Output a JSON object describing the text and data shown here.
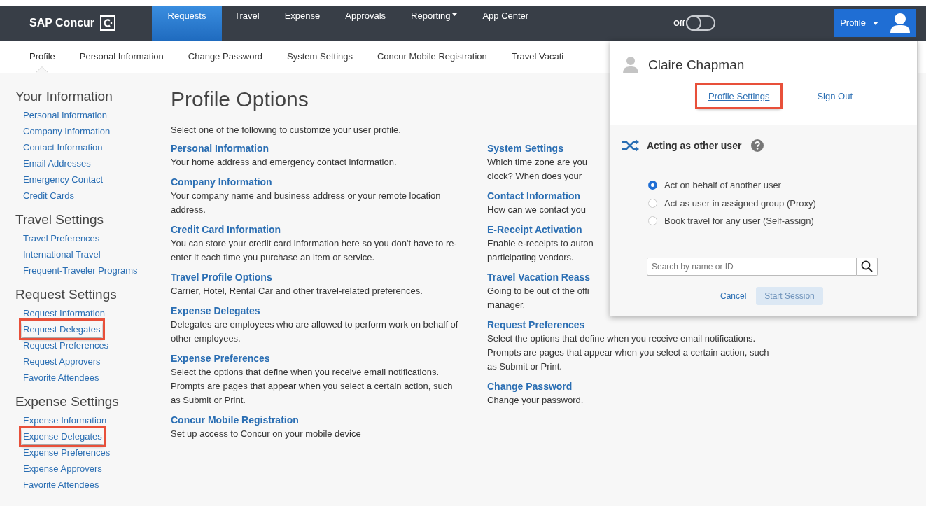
{
  "header": {
    "logo": "SAP Concur",
    "nav": [
      {
        "label": "Requests",
        "selected": true,
        "dropdown": false
      },
      {
        "label": "Travel",
        "selected": false,
        "dropdown": false
      },
      {
        "label": "Expense",
        "selected": false,
        "dropdown": false
      },
      {
        "label": "Approvals",
        "selected": false,
        "dropdown": false
      },
      {
        "label": "Reporting",
        "selected": false,
        "dropdown": true
      },
      {
        "label": "App Center",
        "selected": false,
        "dropdown": false
      }
    ],
    "toggle": {
      "label": "Off",
      "on": false
    },
    "profile_button": "Profile"
  },
  "subnav": [
    {
      "label": "Profile",
      "selected": true
    },
    {
      "label": "Personal Information",
      "selected": false
    },
    {
      "label": "Change Password",
      "selected": false
    },
    {
      "label": "System Settings",
      "selected": false
    },
    {
      "label": "Concur Mobile Registration",
      "selected": false
    },
    {
      "label": "Travel Vacati",
      "selected": false
    }
  ],
  "sidebar": [
    {
      "heading": "Your Information",
      "items": [
        {
          "label": "Personal Information",
          "highlighted": false
        },
        {
          "label": "Company Information",
          "highlighted": false
        },
        {
          "label": "Contact Information",
          "highlighted": false
        },
        {
          "label": "Email Addresses",
          "highlighted": false
        },
        {
          "label": "Emergency Contact",
          "highlighted": false
        },
        {
          "label": "Credit Cards",
          "highlighted": false
        }
      ]
    },
    {
      "heading": "Travel Settings",
      "items": [
        {
          "label": "Travel Preferences",
          "highlighted": false
        },
        {
          "label": "International Travel",
          "highlighted": false
        },
        {
          "label": "Frequent-Traveler Programs",
          "highlighted": false
        }
      ]
    },
    {
      "heading": "Request Settings",
      "items": [
        {
          "label": "Request Information",
          "highlighted": false
        },
        {
          "label": "Request Delegates",
          "highlighted": true
        },
        {
          "label": "Request Preferences",
          "highlighted": false
        },
        {
          "label": "Request Approvers",
          "highlighted": false
        },
        {
          "label": "Favorite Attendees",
          "highlighted": false
        }
      ]
    },
    {
      "heading": "Expense Settings",
      "items": [
        {
          "label": "Expense Information",
          "highlighted": false
        },
        {
          "label": "Expense Delegates",
          "highlighted": true
        },
        {
          "label": "Expense Preferences",
          "highlighted": false
        },
        {
          "label": "Expense Approvers",
          "highlighted": false
        },
        {
          "label": "Favorite Attendees",
          "highlighted": false
        }
      ]
    }
  ],
  "main": {
    "title": "Profile Options",
    "intro": "Select one of the following to customize your user profile.",
    "columns": [
      [
        {
          "title": "Personal Information",
          "text": "Your home address and emergency contact information."
        },
        {
          "title": "Company Information",
          "text": "Your company name and business address or your remote location address."
        },
        {
          "title": "Credit Card Information",
          "text": "You can store your credit card information here so you don't have to re-enter it each time you purchase an item or service."
        },
        {
          "title": "Travel Profile Options",
          "text": "Carrier, Hotel, Rental Car and other travel-related preferences."
        },
        {
          "title": "Expense Delegates",
          "text": "Delegates are employees who are allowed to perform work on behalf of other employees."
        },
        {
          "title": "Expense Preferences",
          "text": "Select the options that define when you receive email notifications. Prompts are pages that appear when you select a certain action, such as Submit or Print."
        },
        {
          "title": "Concur Mobile Registration",
          "text": "Set up access to Concur on your mobile device"
        }
      ],
      [
        {
          "title": "System Settings",
          "lines": [
            "Which time zone are you",
            "clock? When does your"
          ]
        },
        {
          "title": "Contact Information",
          "lines": [
            "How can we contact you"
          ]
        },
        {
          "title": "E-Receipt Activation",
          "lines": [
            "Enable e-receipts to auton",
            "participating vendors."
          ]
        },
        {
          "title": "Travel Vacation Reass",
          "lines": [
            "Going to be out of the offi",
            "manager."
          ]
        },
        {
          "title": "Request Preferences",
          "text": "Select the options that define when you receive email notifications. Prompts are pages that appear when you select a certain action, such as Submit or Print."
        },
        {
          "title": "Change Password",
          "text": "Change your password."
        }
      ]
    ]
  },
  "profile_menu": {
    "user_name": "Claire Chapman",
    "links": [
      {
        "label": "Profile Settings",
        "highlighted": true,
        "underlined": true
      },
      {
        "label": "Sign Out",
        "highlighted": false,
        "underlined": false
      }
    ],
    "acting": {
      "title": "Acting as other user",
      "options": [
        {
          "label": "Act on behalf of another user",
          "selected": true
        },
        {
          "label": "Act as user in assigned group (Proxy)",
          "selected": false
        },
        {
          "label": "Book travel for any user (Self-assign)",
          "selected": false
        }
      ],
      "search": {
        "placeholder": "Search by name or ID"
      },
      "cancel": "Cancel",
      "start": {
        "label": "Start Session",
        "disabled": true
      }
    }
  }
}
